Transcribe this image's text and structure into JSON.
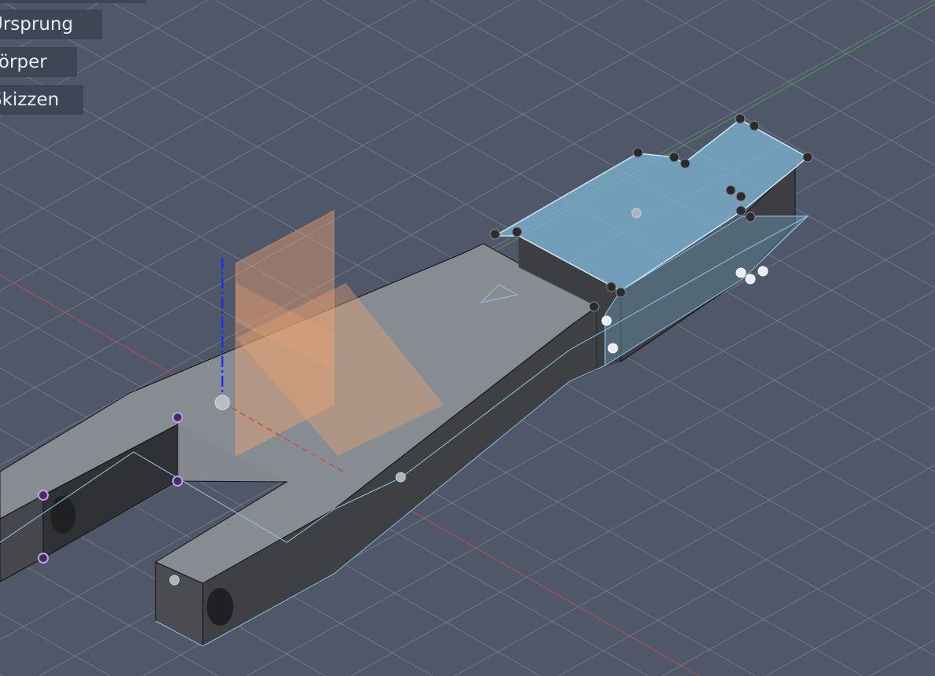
{
  "browser": {
    "items": [
      {
        "label": "Ursprung"
      },
      {
        "label": "Körper"
      },
      {
        "label": "Skizzen"
      }
    ]
  },
  "colors": {
    "background": "#505769",
    "grid": "#8a92a3",
    "body_top": "#8c9096",
    "body_side": "#3e4044",
    "selection": "#7fb6d6",
    "plane": "#e8a273",
    "x_axis": "#c0504d",
    "y_axis": "#3fa34d",
    "z_axis": "#1a2dff"
  }
}
